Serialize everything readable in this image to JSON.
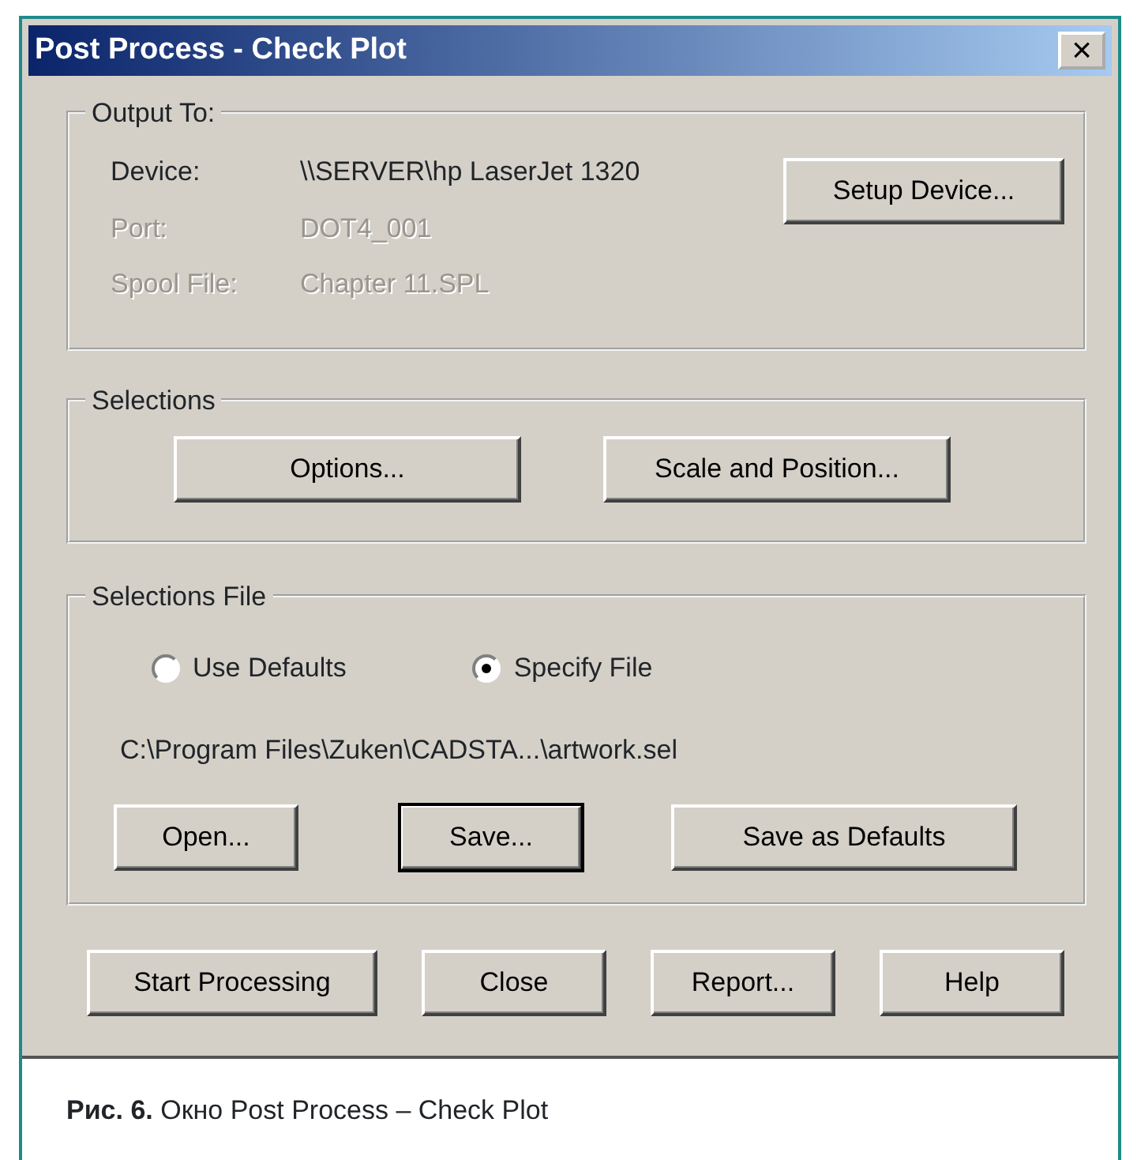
{
  "window": {
    "title": "Post Process - Check Plot",
    "close_glyph": "×"
  },
  "output_group": {
    "title": "Output To:",
    "rows": [
      {
        "label": "Device:",
        "value": "\\\\SERVER\\hp LaserJet 1320",
        "disabled": false
      },
      {
        "label": "Port:",
        "value": "DOT4_001",
        "disabled": true
      },
      {
        "label": "Spool File:",
        "value": "Chapter 11.SPL",
        "disabled": true
      }
    ],
    "button": {
      "label": "Setup Device...",
      "default": false
    }
  },
  "selections_group": {
    "title": "Selections",
    "buttons": [
      {
        "label": "Options...",
        "default": false
      },
      {
        "label": "Scale and Position...",
        "default": false
      }
    ]
  },
  "file_group": {
    "title": "Selections File",
    "radios": [
      {
        "label": "Use Defaults",
        "selected": false
      },
      {
        "label": "Specify File",
        "selected": true
      }
    ],
    "path": "C:\\Program Files\\Zuken\\CADSTA...\\artwork.sel",
    "buttons": [
      {
        "label": "Open...",
        "default": false
      },
      {
        "label": "Save...",
        "default": true
      },
      {
        "label": "Save as Defaults",
        "default": false
      }
    ]
  },
  "buttons": [
    {
      "label": "Start Processing",
      "default": false
    },
    {
      "label": "Close",
      "default": false
    },
    {
      "label": "Report...",
      "default": false
    },
    {
      "label": "Help",
      "default": false
    }
  ],
  "caption": "**Рис. 6.** Окно Post Process – Check Plot"
}
